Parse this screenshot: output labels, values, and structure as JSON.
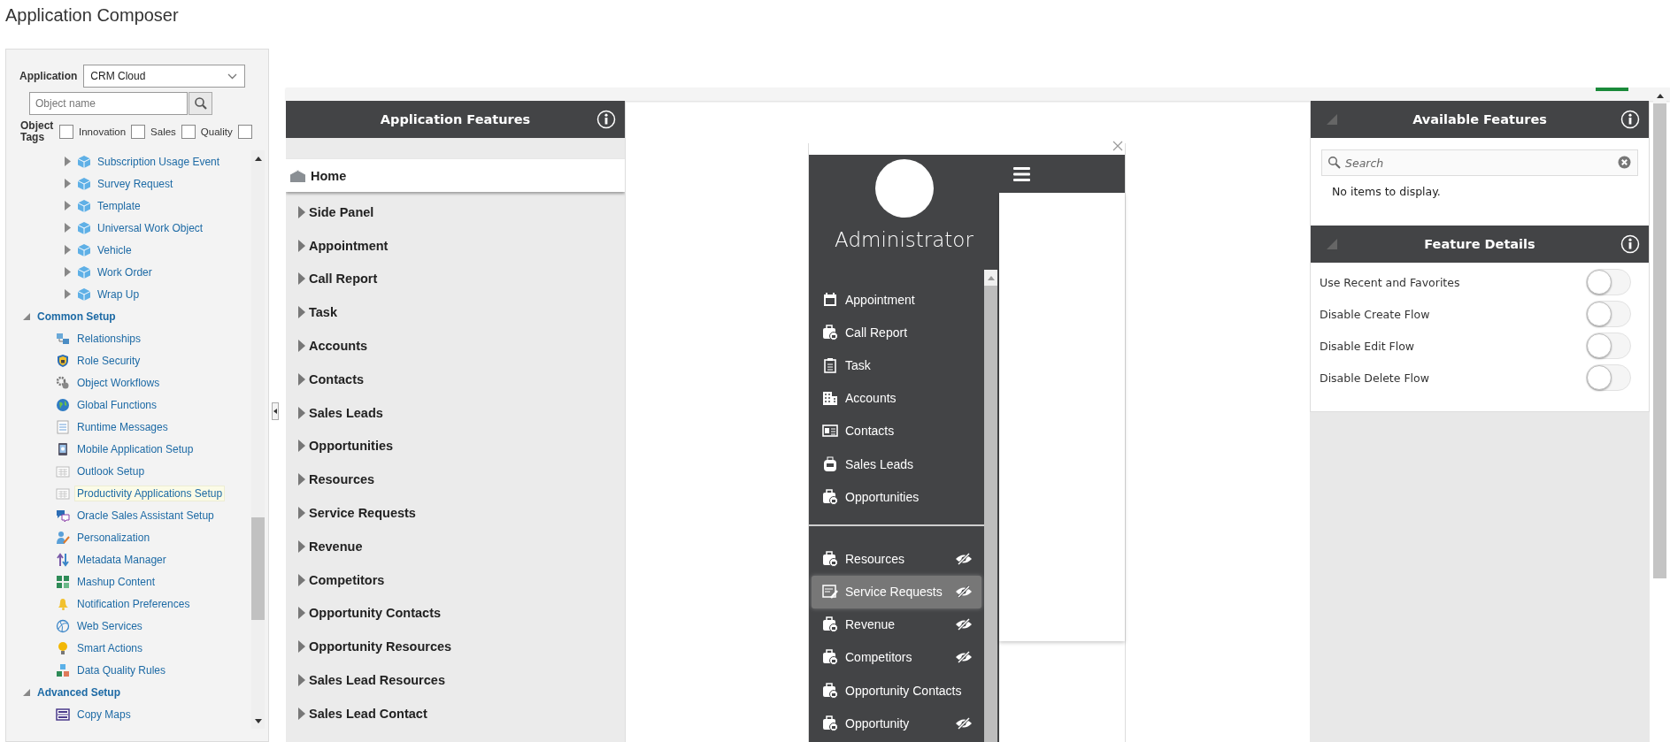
{
  "app_title": "Application Composer",
  "left_panel": {
    "application": {
      "label": "Application",
      "value": "CRM Cloud"
    },
    "search": {
      "placeholder": "Object name"
    },
    "object_tags": {
      "label": "Object Tags",
      "tags": [
        {
          "label": "Innovation",
          "checked": false
        },
        {
          "label": "Sales",
          "checked": false
        },
        {
          "label": "Quality",
          "checked": false
        },
        {
          "checked": false
        }
      ]
    },
    "objects": [
      {
        "label": "Subscription Usage Event",
        "expanded": false
      },
      {
        "label": "Survey Request",
        "expanded": false
      },
      {
        "label": "Template",
        "expanded": false
      },
      {
        "label": "Universal Work Object",
        "expanded": false
      },
      {
        "label": "Vehicle",
        "expanded": false
      },
      {
        "label": "Work Order",
        "expanded": false
      },
      {
        "label": "Wrap Up",
        "expanded": false
      }
    ],
    "groups": [
      {
        "label": "Common Setup",
        "expanded": true,
        "children": [
          {
            "label": "Relationships",
            "selected": false
          },
          {
            "label": "Role Security",
            "selected": false
          },
          {
            "label": "Object Workflows",
            "selected": false
          },
          {
            "label": "Global Functions",
            "selected": false
          },
          {
            "label": "Runtime Messages",
            "selected": false
          },
          {
            "label": "Mobile Application Setup",
            "selected": false
          },
          {
            "label": "Outlook Setup",
            "selected": false
          },
          {
            "label": "Productivity Applications Setup",
            "selected": true
          },
          {
            "label": "Oracle Sales Assistant Setup",
            "selected": false
          },
          {
            "label": "Personalization",
            "selected": false
          },
          {
            "label": "Metadata Manager",
            "selected": false
          },
          {
            "label": "Mashup Content",
            "selected": false
          },
          {
            "label": "Notification Preferences",
            "selected": false
          },
          {
            "label": "Web Services",
            "selected": false
          },
          {
            "label": "Smart Actions",
            "selected": false
          },
          {
            "label": "Data Quality Rules",
            "selected": false
          }
        ]
      },
      {
        "label": "Advanced Setup",
        "expanded": true,
        "children": [
          {
            "label": "Copy Maps",
            "selected": false
          }
        ]
      }
    ]
  },
  "application_features": {
    "title": "Application Features",
    "items": [
      {
        "kind": "home",
        "label": "Home",
        "selected": true
      },
      {
        "kind": "group",
        "label": "Side Panel",
        "selected": false
      },
      {
        "kind": "group",
        "label": "Appointment",
        "selected": false
      },
      {
        "kind": "group",
        "label": "Call Report",
        "selected": false
      },
      {
        "kind": "group",
        "label": "Task",
        "selected": false
      },
      {
        "kind": "group",
        "label": "Accounts",
        "selected": false
      },
      {
        "kind": "group",
        "label": "Contacts",
        "selected": false
      },
      {
        "kind": "group",
        "label": "Sales Leads",
        "selected": false
      },
      {
        "kind": "group",
        "label": "Opportunities",
        "selected": false
      },
      {
        "kind": "group",
        "label": "Resources",
        "selected": false
      },
      {
        "kind": "group",
        "label": "Service Requests",
        "selected": false
      },
      {
        "kind": "group",
        "label": "Revenue",
        "selected": false
      },
      {
        "kind": "group",
        "label": "Competitors",
        "selected": false
      },
      {
        "kind": "group",
        "label": "Opportunity Contacts",
        "selected": false
      },
      {
        "kind": "group",
        "label": "Opportunity Resources",
        "selected": false
      },
      {
        "kind": "group",
        "label": "Sales Lead Resources",
        "selected": false
      },
      {
        "kind": "group",
        "label": "Sales Lead Contact",
        "selected": false
      }
    ]
  },
  "preview": {
    "user": "Administrator",
    "primary_menu": [
      {
        "label": "Appointment",
        "hidden": false,
        "selected": false
      },
      {
        "label": "Call Report",
        "hidden": false,
        "selected": false
      },
      {
        "label": "Task",
        "hidden": false,
        "selected": false
      },
      {
        "label": "Accounts",
        "hidden": false,
        "selected": false
      },
      {
        "label": "Contacts",
        "hidden": false,
        "selected": false
      },
      {
        "label": "Sales Leads",
        "hidden": false,
        "selected": false
      },
      {
        "label": "Opportunities",
        "hidden": false,
        "selected": false
      }
    ],
    "secondary_menu": [
      {
        "label": "Resources",
        "hidden": true,
        "selected": false
      },
      {
        "label": "Service Requests",
        "hidden": true,
        "selected": true
      },
      {
        "label": "Revenue",
        "hidden": true,
        "selected": false
      },
      {
        "label": "Competitors",
        "hidden": true,
        "selected": false
      },
      {
        "label": "Opportunity Contacts",
        "hidden": false,
        "selected": false
      },
      {
        "label": "Opportunity",
        "hidden": true,
        "selected": false
      }
    ]
  },
  "available_features": {
    "title": "Available Features",
    "search": {
      "placeholder": "Search"
    },
    "empty_message": "No items to display."
  },
  "feature_details": {
    "title": "Feature Details",
    "options": [
      {
        "label": "Use Recent and Favorites",
        "on": false
      },
      {
        "label": "Disable Create Flow",
        "on": false
      },
      {
        "label": "Disable Edit Flow",
        "on": false
      },
      {
        "label": "Disable Delete Flow",
        "on": false
      }
    ]
  }
}
